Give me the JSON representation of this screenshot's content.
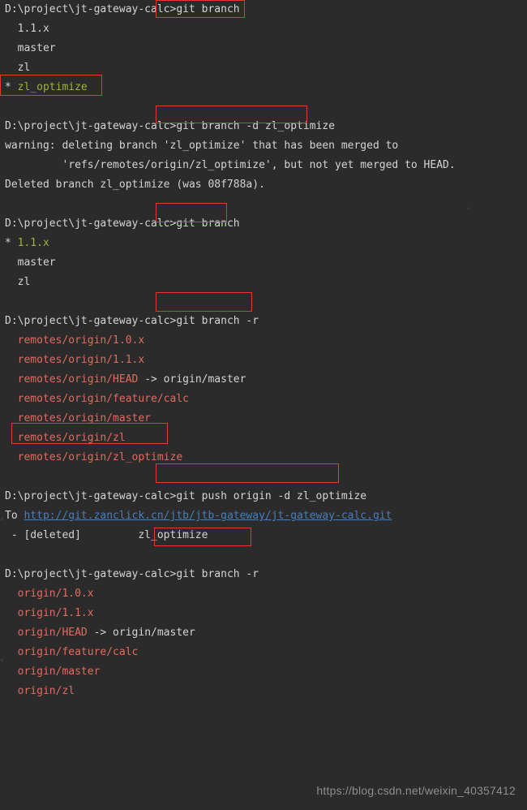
{
  "terminal": {
    "prompt": "D:\\project\\jt-gateway-calc>",
    "background_color": "#2b2b2b",
    "text_color": "#d4d4d4",
    "current_branch_color": "#9eb33a",
    "remote_branch_color": "#e06c5e",
    "link_color": "#4a7ebb",
    "annotation_color": "#e43b2c"
  },
  "blocks": {
    "b1": {
      "command": "git branch",
      "out1": "  1.1.x",
      "out2": "  master",
      "out3": "  zl",
      "out4_marker": "* ",
      "out4_branch": "zl_optimize"
    },
    "b2": {
      "command": "git branch -d zl_optimize",
      "out1": "warning: deleting branch 'zl_optimize' that has been merged to",
      "out2": "         'refs/remotes/origin/zl_optimize', but not yet merged to HEAD.",
      "out3": "Deleted branch zl_optimize (was 08f788a)."
    },
    "b3": {
      "command": "git branch",
      "out1_marker": "* ",
      "out1_branch": "1.1.x",
      "out2": "  master",
      "out3": "  zl"
    },
    "b4": {
      "command": "git branch -r",
      "out1": "  remotes/origin/1.0.x",
      "out2": "  remotes/origin/1.1.x",
      "out3_branch": "  remotes/origin/HEAD",
      "out3_arrow": " -> origin/master",
      "out4": "  remotes/origin/feature/calc",
      "out5": "  remotes/origin/master",
      "out6": "  remotes/origin/zl",
      "out7": "  remotes/origin/zl_optimize"
    },
    "b5": {
      "command": "git push origin -d zl_optimize",
      "out1_prefix": "To ",
      "out1_url": "http://git.zanclick.cn/jtb/jtb-gateway/jt-gateway-calc.git",
      "out2": " - [deleted]         zl_optimize"
    },
    "b6": {
      "command": "git branch -r",
      "out1": "  origin/1.0.x",
      "out2": "  origin/1.1.x",
      "out3_branch": "  origin/HEAD",
      "out3_arrow": " -> origin/master",
      "out4": "  origin/feature/calc",
      "out5": "  origin/master",
      "out6": "  origin/zl"
    }
  },
  "watermark": {
    "text": "https://blog.csdn.net/weixin_40357412"
  }
}
